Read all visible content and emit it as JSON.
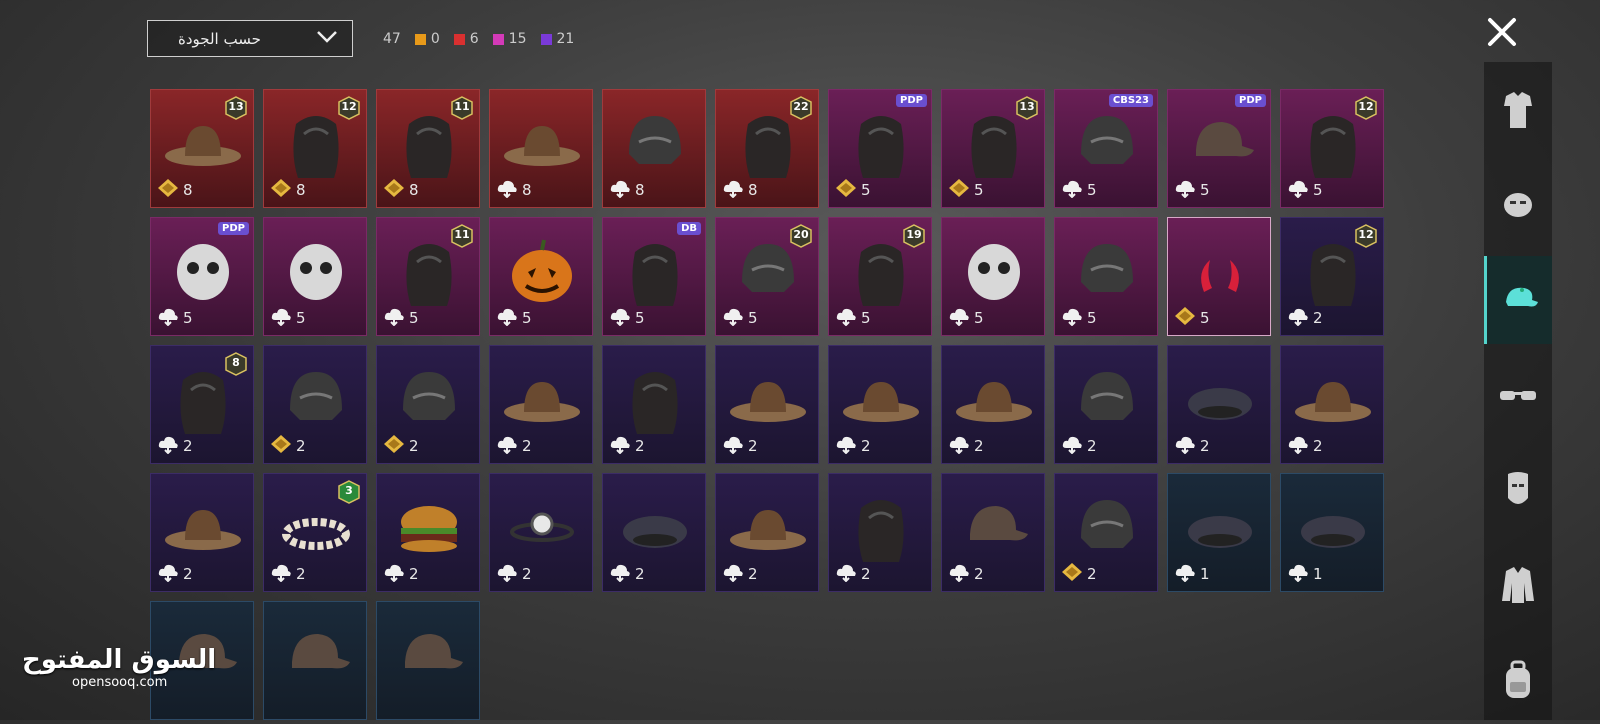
{
  "header": {
    "sort_label": "حسب الجودة",
    "total_count": "47",
    "rarity_counts": [
      {
        "color": "#e89a1a",
        "value": "0"
      },
      {
        "color": "#d93030",
        "value": "6"
      },
      {
        "color": "#d43ab8",
        "value": "15"
      },
      {
        "color": "#7a3ad9",
        "value": "21"
      }
    ]
  },
  "sidebar": {
    "categories": [
      {
        "icon": "outfit-icon",
        "active": false
      },
      {
        "icon": "face-icon",
        "active": false
      },
      {
        "icon": "cap-icon",
        "active": true
      },
      {
        "icon": "glasses-icon",
        "active": false
      },
      {
        "icon": "mask-icon",
        "active": false
      },
      {
        "icon": "jacket-icon",
        "active": false
      },
      {
        "icon": "backpack-icon",
        "active": false
      }
    ]
  },
  "items": [
    {
      "tier": "red",
      "count": "8",
      "currency": "gold",
      "badge": "13",
      "art": "hat"
    },
    {
      "tier": "red",
      "count": "8",
      "currency": "gold",
      "badge": "12",
      "art": "hair"
    },
    {
      "tier": "red",
      "count": "8",
      "currency": "gold",
      "badge": "11",
      "art": "hair"
    },
    {
      "tier": "red",
      "count": "8",
      "currency": "cloud",
      "badge": "",
      "art": "hat"
    },
    {
      "tier": "red",
      "count": "8",
      "currency": "cloud",
      "badge": "",
      "art": "helmet"
    },
    {
      "tier": "red",
      "count": "8",
      "currency": "cloud",
      "badge": "22",
      "art": "hair"
    },
    {
      "tier": "pink",
      "count": "5",
      "currency": "gold",
      "tag": "PDP",
      "art": "hair"
    },
    {
      "tier": "pink",
      "count": "5",
      "currency": "gold",
      "badge": "13",
      "art": "hair"
    },
    {
      "tier": "pink",
      "count": "5",
      "currency": "cloud",
      "tag": "CBS23",
      "art": "helmet"
    },
    {
      "tier": "pink",
      "count": "5",
      "currency": "cloud",
      "tag": "PDP",
      "art": "cap"
    },
    {
      "tier": "pink",
      "count": "5",
      "currency": "cloud",
      "badge": "12",
      "art": "hair"
    },
    {
      "tier": "pink",
      "count": "5",
      "currency": "cloud",
      "tag": "PDP",
      "art": "head"
    },
    {
      "tier": "pink",
      "count": "5",
      "currency": "cloud",
      "art": "head"
    },
    {
      "tier": "pink",
      "count": "5",
      "currency": "cloud",
      "badge": "11",
      "art": "hair"
    },
    {
      "tier": "pink",
      "count": "5",
      "currency": "cloud",
      "art": "pumpkin"
    },
    {
      "tier": "pink",
      "count": "5",
      "currency": "cloud",
      "tag": "DB",
      "art": "hair"
    },
    {
      "tier": "pink",
      "count": "5",
      "currency": "cloud",
      "badge": "20",
      "art": "helmet"
    },
    {
      "tier": "pink",
      "count": "5",
      "currency": "cloud",
      "badge": "19",
      "art": "hair"
    },
    {
      "tier": "pink",
      "count": "5",
      "currency": "cloud",
      "art": "head"
    },
    {
      "tier": "pink",
      "count": "5",
      "currency": "cloud",
      "art": "helmet"
    },
    {
      "tier": "pink",
      "count": "5",
      "currency": "gold",
      "selected": true,
      "art": "horns"
    },
    {
      "tier": "purple",
      "count": "2",
      "currency": "cloud",
      "badge": "12",
      "art": "hair"
    },
    {
      "tier": "purple",
      "count": "2",
      "currency": "cloud",
      "badge": "8",
      "art": "hair"
    },
    {
      "tier": "purple",
      "count": "2",
      "currency": "gold",
      "art": "helmet"
    },
    {
      "tier": "purple",
      "count": "2",
      "currency": "gold",
      "art": "helmet"
    },
    {
      "tier": "purple",
      "count": "2",
      "currency": "cloud",
      "art": "hat"
    },
    {
      "tier": "purple",
      "count": "2",
      "currency": "cloud",
      "art": "hair"
    },
    {
      "tier": "purple",
      "count": "2",
      "currency": "cloud",
      "art": "hat"
    },
    {
      "tier": "purple",
      "count": "2",
      "currency": "cloud",
      "art": "hat"
    },
    {
      "tier": "purple",
      "count": "2",
      "currency": "cloud",
      "art": "hat"
    },
    {
      "tier": "purple",
      "count": "2",
      "currency": "cloud",
      "art": "helmet"
    },
    {
      "tier": "purple",
      "count": "2",
      "currency": "cloud",
      "art": "beret"
    },
    {
      "tier": "purple",
      "count": "2",
      "currency": "cloud",
      "art": "hat"
    },
    {
      "tier": "purple",
      "count": "2",
      "currency": "cloud",
      "art": "hat"
    },
    {
      "tier": "purple",
      "count": "2",
      "currency": "cloud",
      "badge": "3",
      "art": "wreath"
    },
    {
      "tier": "purple",
      "count": "2",
      "currency": "cloud",
      "art": "burger"
    },
    {
      "tier": "purple",
      "count": "2",
      "currency": "cloud",
      "art": "headlamp"
    },
    {
      "tier": "purple",
      "count": "2",
      "currency": "cloud",
      "art": "beret"
    },
    {
      "tier": "purple",
      "count": "2",
      "currency": "cloud",
      "art": "hat"
    },
    {
      "tier": "purple",
      "count": "2",
      "currency": "cloud",
      "art": "hair"
    },
    {
      "tier": "purple",
      "count": "2",
      "currency": "cloud",
      "art": "cap"
    },
    {
      "tier": "purple",
      "count": "2",
      "currency": "gold",
      "art": "helmet"
    },
    {
      "tier": "blue",
      "count": "1",
      "currency": "cloud",
      "art": "beret"
    },
    {
      "tier": "blue",
      "count": "1",
      "currency": "cloud",
      "art": "beret"
    },
    {
      "tier": "blue",
      "count": "",
      "currency": "none",
      "art": "cap"
    },
    {
      "tier": "blue",
      "count": "",
      "currency": "none",
      "art": "cap"
    },
    {
      "tier": "blue",
      "count": "",
      "currency": "none",
      "art": "cap"
    }
  ],
  "watermark": {
    "arabic": "السوق المفتوح",
    "latin": "opensooq.com"
  }
}
